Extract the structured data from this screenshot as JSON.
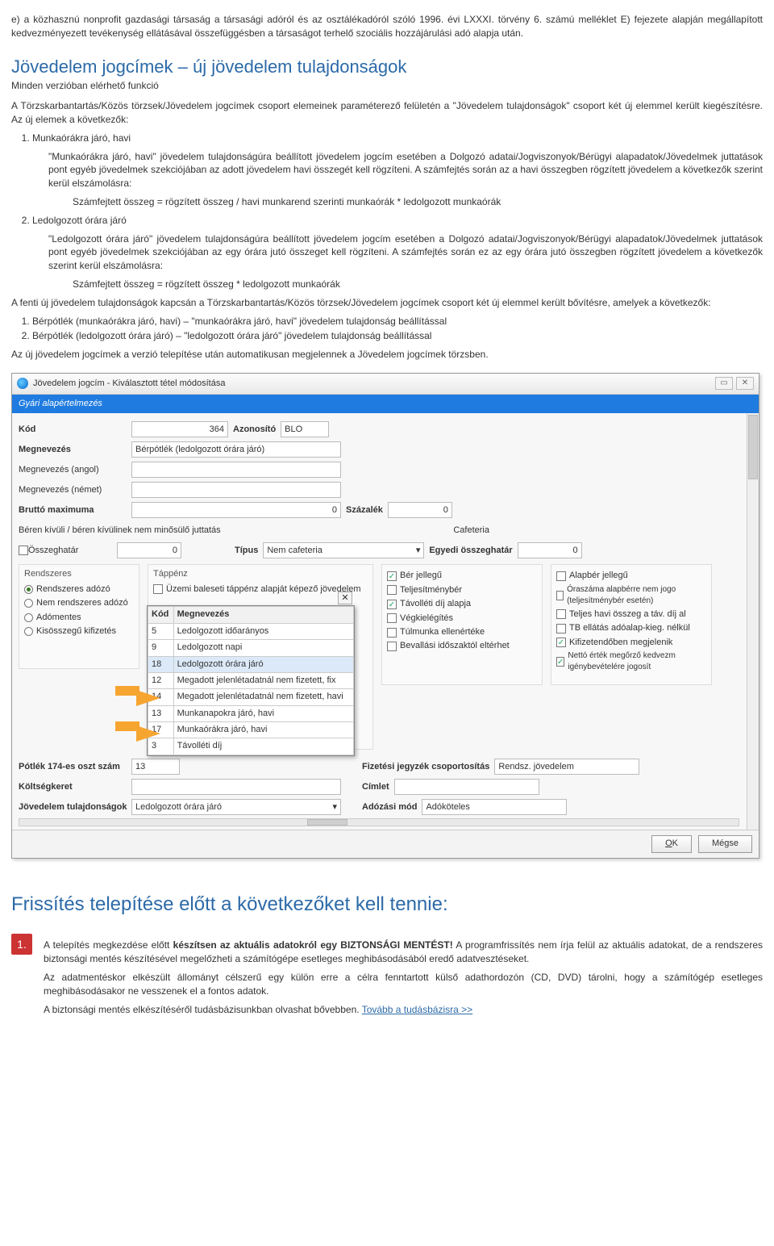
{
  "intro_para": "e) a közhasznú nonprofit gazdasági társaság a társasági adóról és az osztálékadóról szóló 1996. évi LXXXI. törvény 6. számú melléklet E) fejezete alapján megállapított kedvezményezett tevékenység ellátásával összefüggésben a társaságot terhelő szociális hozzájárulási adó alapja után.",
  "h_main": "Jövedelem jogcímek – új jövedelem tulajdonságok",
  "h_main_sub": "Minden verzióban elérhető funkció",
  "p_desc": "A Törzskarbantartás/Közös törzsek/Jövedelem jogcímek csoport elemeinek paraméterező felületén a \"Jövedelem tulajdonságok\" csoport két új elemmel került kiegészítésre. Az új elemek a következők:",
  "li1_title": "Munkaórákra járó, havi",
  "li1_body1": "\"Munkaórákra járó, havi\" jövedelem tulajdonságúra beállított jövedelem jogcím esetében a Dolgozó adatai/Jogviszonyok/Bérügyi alapadatok/Jövedelmek juttatások pont egyéb jövedelmek szekciójában az adott jövedelem havi összegét kell rögzíteni. A számfejtés során az a havi összegben rögzített jövedelem a következők szerint kerül elszámolásra:",
  "li1_formula": "Számfejtett összeg = rögzített összeg / havi munkarend szerinti munkaórák * ledolgozott munkaórák",
  "li2_title": "Ledolgozott órára járó",
  "li2_body1": "\"Ledolgozott órára járó\" jövedelem tulajdonságúra beállított jövedelem jogcím esetében a Dolgozó adatai/Jogviszonyok/Bérügyi alapadatok/Jövedelmek juttatások pont egyéb jövedelmek szekciójában az egy órára jutó összeget kell rögzíteni. A számfejtés során ez az egy órára jutó összegben rögzített jövedelem a következők szerint kerül elszámolásra:",
  "li2_formula": "Számfejtett összeg = rögzített összeg * ledolgozott munkaórák",
  "p_after": "A fenti új jövedelem tulajdonságok kapcsán a Törzskarbantartás/Közös törzsek/Jövedelem jogcímek csoport két új elemmel került bővítésre, amelyek a következők:",
  "after_items": [
    "Bérpótlék (munkaórákra járó, havi) – \"munkaórákra járó, havi\" jövedelem tulajdonság beállítással",
    "Bérpótlék (ledolgozott órára járó) – \"ledolgozott órára járó\" jövedelem tulajdonság beállítással"
  ],
  "p_auto": "Az új jövedelem jogcímek a verzió telepítése után automatikusan megjelennek a Jövedelem jogcímek törzsben.",
  "dialog": {
    "title": "Jövedelem jogcím - Kiválasztott tétel módosítása",
    "restore": "▭",
    "close": "✕",
    "section": "Gyári alapértelmezés",
    "labels": {
      "kod": "Kód",
      "azon": "Azonosító",
      "megnev": "Megnevezés",
      "megnev_en": "Megnevezés (angol)",
      "megnev_de": "Megnevezés (német)",
      "brutto": "Bruttó maximuma",
      "szazalek": "Százalék",
      "beren": "Béren kívüli / béren kívülinek nem minősülő juttatás",
      "cafeteria": "Cafeteria",
      "osszeghatar": "Összeghatár",
      "tipus": "Típus",
      "egyedi": "Egyedi összeghatár",
      "rendszeres": "Rendszeres",
      "tappenz": "Táppénz",
      "potlek174": "Pótlék 174-es oszt szám",
      "koltseg": "Költségkeret",
      "jov_tul": "Jövedelem tulajdonságok",
      "fiz_csop": "Fizetési jegyzék csoportosítás",
      "cimlet": "Címlet",
      "adozasi": "Adózási mód"
    },
    "values": {
      "kod": "364",
      "azon": "BLO",
      "megnev": "Bérpótlék (ledolgozott órára járó)",
      "brutto": "0",
      "szazalek": "0",
      "osszeghatar": "0",
      "tipus": "Nem cafeteria",
      "egyedi": "0",
      "potlek174": "13",
      "jov_tul": "Ledolgozott órára járó",
      "fiz_csop": "Rendsz. jövedelem",
      "adozasi": "Adóköteles"
    },
    "rend_opts": [
      "Rendszeres adózó",
      "Nem rendszeres adózó",
      "Adómentes",
      "Kisösszegű kifizetés"
    ],
    "tappenz_opts": [
      "Üzemi baleseti táppénz alapját képező jövedelem"
    ],
    "col3": [
      "Bér jellegű",
      "Teljesítménybér",
      "Távolléti díj alapja",
      "Végkielégítés",
      "Túlmunka ellenértéke",
      "Bevallási időszaktól eltérhet"
    ],
    "col3_checked": [
      true,
      false,
      true,
      false,
      false,
      false
    ],
    "col4": [
      "Alapbér jellegű",
      "Óraszáma alapbérre nem jogo (teljesítménybér esetén)",
      "Teljes havi összeg a táv. díj al",
      "TB ellátás adóalap-kieg. nélkül",
      "Kifizetendőben megjelenik",
      "Nettó érték megőrző kedvezm igénybevételére jogosít"
    ],
    "col4_checked": [
      false,
      false,
      false,
      false,
      true,
      true
    ],
    "dropdown": {
      "close": "✕",
      "headers": [
        "Kód",
        "Megnevezés"
      ],
      "rows": [
        [
          "5",
          "Ledolgozott időarányos"
        ],
        [
          "9",
          "Ledolgozott napi"
        ],
        [
          "18",
          "Ledolgozott órára járó"
        ],
        [
          "12",
          "Megadott jelenlétadatnál nem fizetett, fix"
        ],
        [
          "14",
          "Megadott jelenlétadatnál nem fizetett, havi"
        ],
        [
          "13",
          "Munkanapokra járó, havi"
        ],
        [
          "17",
          "Munkaórákra járó, havi"
        ],
        [
          "3",
          "Távolléti díj"
        ]
      ],
      "selected_index": 2
    },
    "buttons": {
      "ok": "OK",
      "cancel": "Mégse"
    }
  },
  "h_install": "Frissítés telepítése előtt a következőket kell tennie:",
  "step1": {
    "num": "1.",
    "p1a": "A telepítés megkezdése előtt ",
    "p1b": "készítsen az aktuális adatokról egy BIZTONSÁGI MENTÉST!",
    "p1c": " A programfrissítés nem írja felül az aktuális adatokat, de a rendszeres biztonsági mentés készítésével megelőzheti a számítógépe esetleges meghibásodásából eredő adatvesztéseket.",
    "p2": "Az adatmentéskor elkészült állományt célszerű egy külön erre a célra fenntartott külső adathordozón (CD, DVD) tárolni, hogy a számítógép esetleges meghibásodásakor ne vesszenek el a fontos adatok.",
    "p3a": "A biztonsági mentés elkészítéséről tudásbázisunkban olvashat bővebben. ",
    "p3b": "Tovább a tudásbázisra >>"
  }
}
